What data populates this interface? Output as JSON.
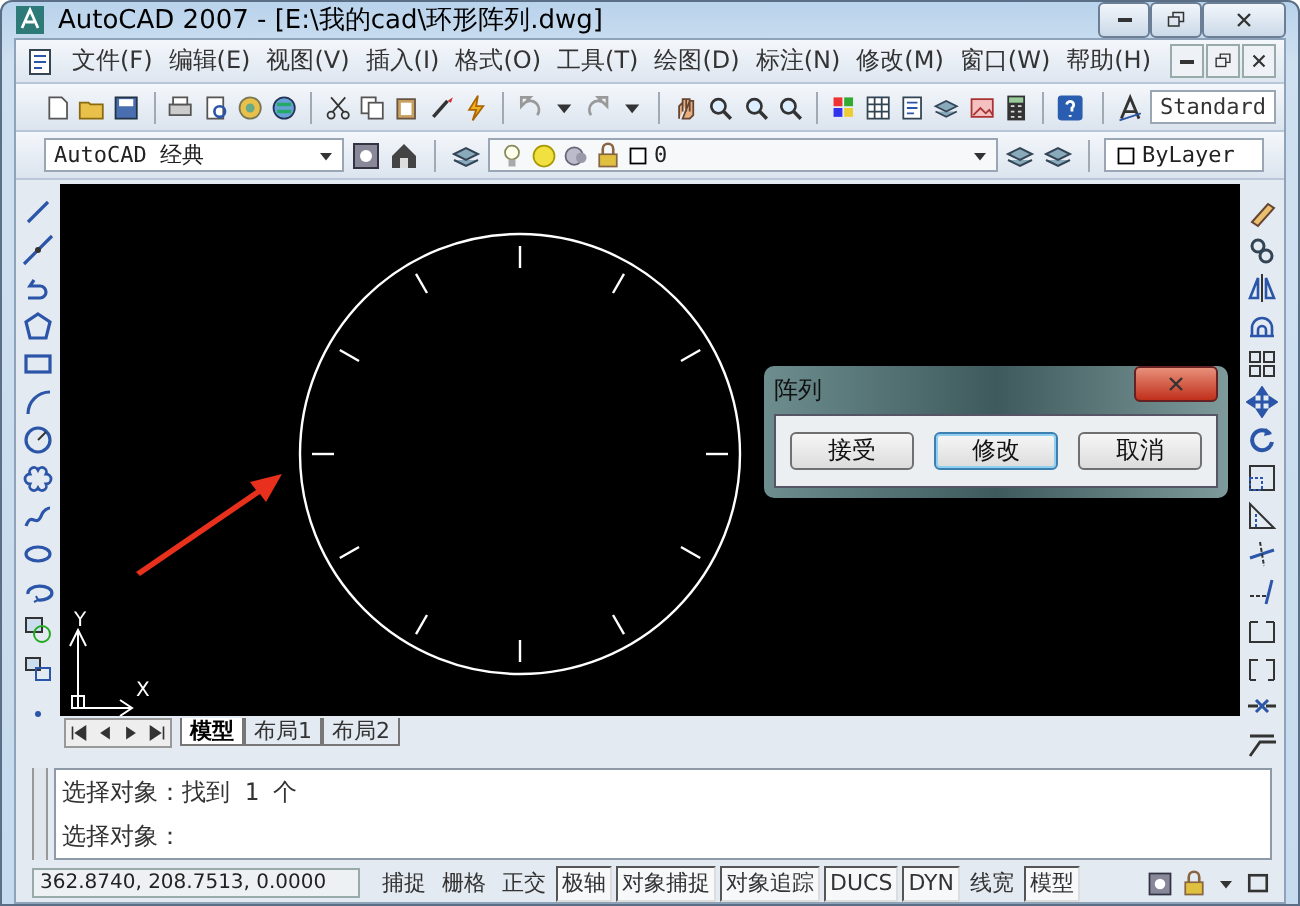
{
  "window": {
    "title": "AutoCAD 2007 - [E:\\我的cad\\环形阵列.dwg]"
  },
  "menu": [
    "文件(F)",
    "编辑(E)",
    "视图(V)",
    "插入(I)",
    "格式(O)",
    "工具(T)",
    "绘图(D)",
    "标注(N)",
    "修改(M)",
    "窗口(W)",
    "帮助(H)"
  ],
  "text_style": {
    "value": "Standard"
  },
  "workspace": {
    "value": "AutoCAD 经典"
  },
  "layer": {
    "value": "0"
  },
  "color": {
    "value": "ByLayer"
  },
  "ucs": {
    "x_label": "X",
    "y_label": "Y"
  },
  "dialog": {
    "title": "阵列",
    "buttons": [
      {
        "label": "接受",
        "focused": false
      },
      {
        "label": "修改",
        "focused": true
      },
      {
        "label": "取消",
        "focused": false
      }
    ]
  },
  "layout_tabs": [
    {
      "label": "模型",
      "selected": true
    },
    {
      "label": "布局1",
      "selected": false
    },
    {
      "label": "布局2",
      "selected": false
    }
  ],
  "command_lines": [
    "选择对象：找到 1 个",
    "选择对象："
  ],
  "status_bar": {
    "coordinates": "362.8740, 208.7513, 0.0000",
    "toggles": [
      {
        "label": "捕捉",
        "on": false
      },
      {
        "label": "栅格",
        "on": false
      },
      {
        "label": "正交",
        "on": false
      },
      {
        "label": "极轴",
        "on": true
      },
      {
        "label": "对象捕捉",
        "on": true
      },
      {
        "label": "对象追踪",
        "on": true
      },
      {
        "label": "DUCS",
        "on": true
      },
      {
        "label": "DYN",
        "on": true
      },
      {
        "label": "线宽",
        "on": false
      },
      {
        "label": "模型",
        "on": true
      }
    ]
  }
}
